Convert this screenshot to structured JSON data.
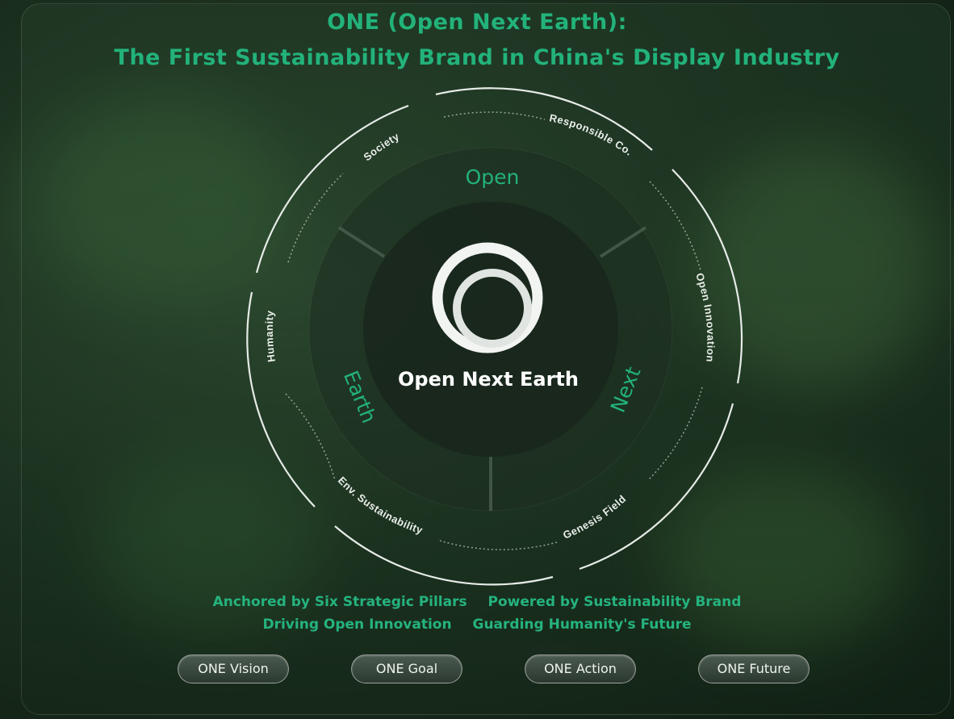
{
  "header": {
    "title_line1": "ONE (Open Next Earth):",
    "title_line2": "The First Sustainability Brand in China's Display Industry"
  },
  "diagram": {
    "center_label": "Open Next Earth",
    "inner_segments": [
      "Open",
      "Next",
      "Earth"
    ],
    "pillars": [
      "Society",
      "Responsible Co.",
      "Open Innovation",
      "Genesis Field",
      "Env. Sustainability",
      "Humanity"
    ]
  },
  "taglines": {
    "line1": [
      "Anchored by Six Strategic Pillars",
      "Powered by Sustainability Brand"
    ],
    "line2": [
      "Driving Open Innovation",
      "Guarding Humanity's Future"
    ]
  },
  "nav_buttons": [
    "ONE Vision",
    "ONE Goal",
    "ONE Action",
    "ONE Future"
  ],
  "colors": {
    "accent": "#22b27a",
    "ring": "#e6ebe7"
  }
}
